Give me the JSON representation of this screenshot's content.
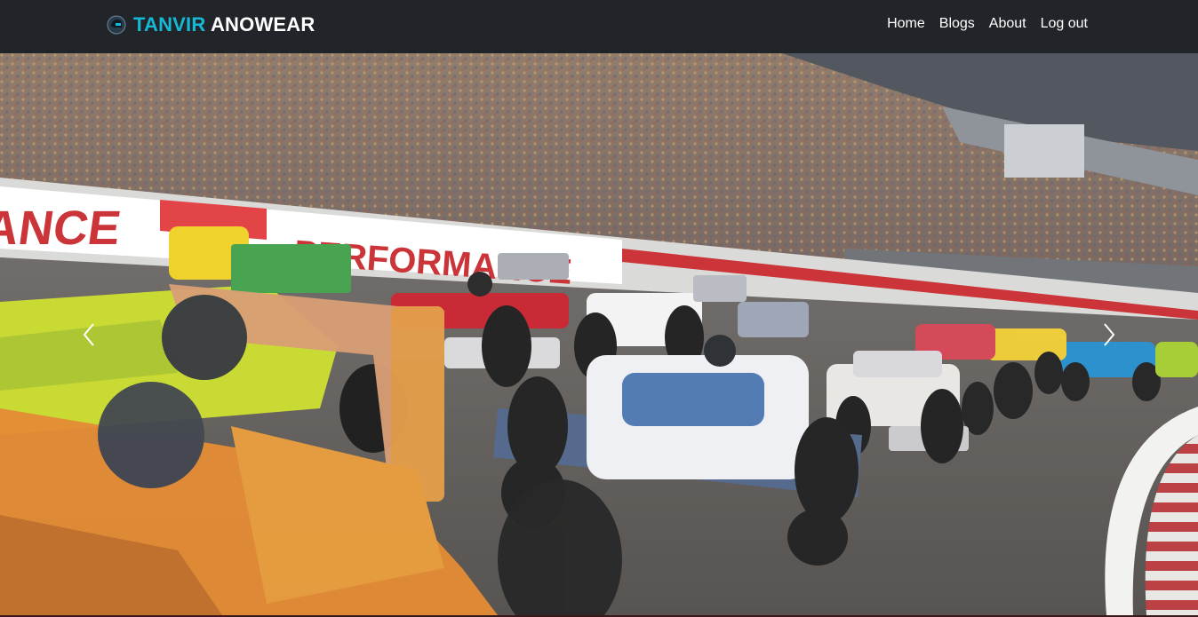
{
  "navbar": {
    "brand_accent": "TANVIR",
    "brand_main": "ANOWEAR",
    "logo_icon": "racing-helmet-icon",
    "links": [
      {
        "label": "Home"
      },
      {
        "label": "Blogs"
      },
      {
        "label": "About"
      },
      {
        "label": "Log out"
      }
    ]
  },
  "carousel": {
    "slide_image": "formula-racing-cars-on-track-in-stadium",
    "prev_icon": "chevron-left-icon",
    "next_icon": "chevron-right-icon"
  },
  "colors": {
    "navbar_bg": "#212529",
    "brand_accent": "#17b8d6",
    "brand_main": "#ffffff",
    "nav_text": "#ffffff"
  }
}
